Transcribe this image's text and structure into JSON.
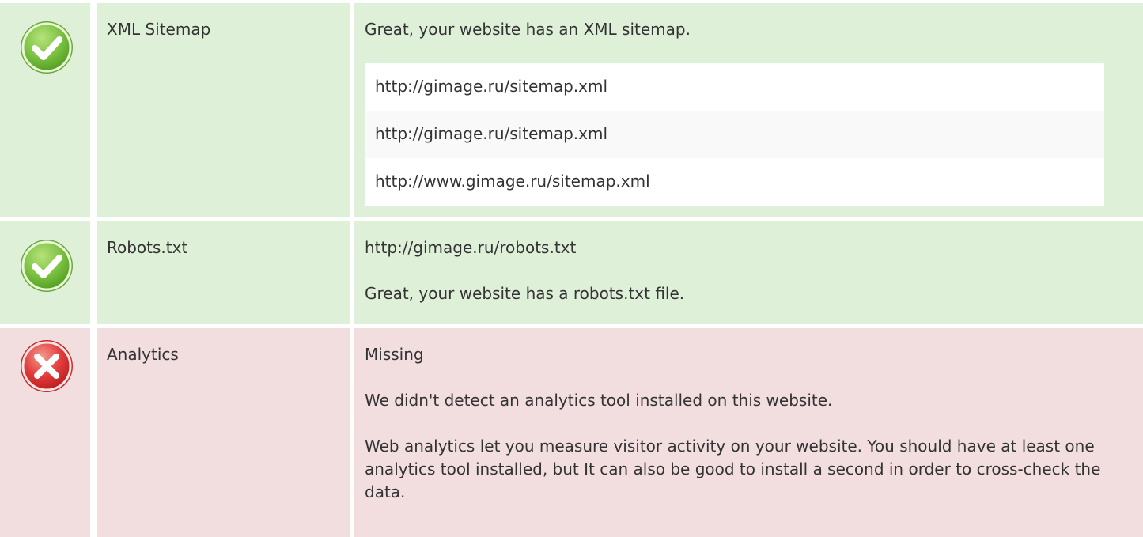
{
  "checks": [
    {
      "status": "pass",
      "icon": "check-icon",
      "name": "XML Sitemap",
      "message": "Great, your website has an XML sitemap.",
      "urls": [
        "http://gimage.ru/sitemap.xml",
        "http://gimage.ru/sitemap.xml",
        "http://www.gimage.ru/sitemap.xml"
      ]
    },
    {
      "status": "pass",
      "icon": "check-icon",
      "name": "Robots.txt",
      "url": "http://gimage.ru/robots.txt",
      "message": "Great, your website has a robots.txt file."
    },
    {
      "status": "fail",
      "icon": "cross-icon",
      "name": "Analytics",
      "value": "Missing",
      "message": "We didn't detect an analytics tool installed on this website.",
      "advice": "Web analytics let you measure visitor activity on your website. You should have at least one analytics tool installed, but It can also be good to install a second in order to cross-check the data."
    }
  ],
  "colors": {
    "pass_bg": "#dff0d8",
    "fail_bg": "#f2dedf",
    "pass_icon": "#7cc242",
    "fail_icon": "#e23b3b"
  }
}
